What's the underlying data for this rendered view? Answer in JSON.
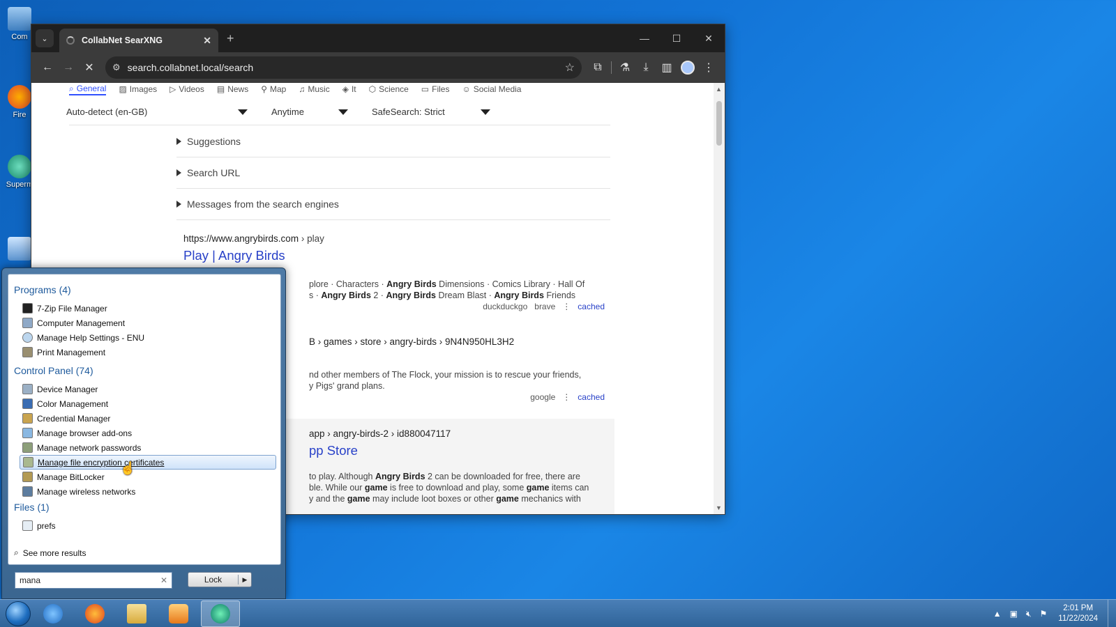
{
  "desktop": {
    "icons": [
      {
        "label": "Com",
        "icon": "computer-icon"
      },
      {
        "label": "Fire",
        "icon": "firefox-shortcut-icon"
      },
      {
        "label": "Superm",
        "icon": "app-shortcut-icon"
      },
      {
        "label": "",
        "icon": "shortcut-icon"
      }
    ]
  },
  "browser": {
    "tab_title": "CollabNet SearXNG",
    "url": "search.collabnet.local/search",
    "categories": [
      "General",
      "Images",
      "Videos",
      "News",
      "Map",
      "Music",
      "It",
      "Science",
      "Files",
      "Social Media"
    ],
    "filters": {
      "language": "Auto-detect (en-GB)",
      "time": "Anytime",
      "safesearch": "SafeSearch: Strict"
    },
    "expanders": [
      "Suggestions",
      "Search URL",
      "Messages from the search engines"
    ],
    "results": [
      {
        "url": "https://www.angrybirds.com",
        "crumb": "› play",
        "title": "Play | Angry Birds",
        "snippet_html_1": "plore · Characters · <b>Angry Birds</b> Dimensions · Comics Library · Hall Of",
        "snippet_html_2": "s · <b>Angry Birds</b> 2 · <b>Angry Birds</b> Dream Blast · <b>Angry Birds</b> Friends",
        "engines": [
          "duckduckgo",
          "brave"
        ],
        "cached": "cached"
      },
      {
        "url": "B › games › store › angry-birds › 9N4N950HL3H2",
        "snippet_html_1": "nd other members of The Flock, your mission is to rescue your friends,",
        "snippet_html_2": "y Pigs' grand plans.",
        "engines": [
          "google"
        ],
        "cached": "cached"
      },
      {
        "url": "app › angry-birds-2 › id880047117",
        "title": "pp Store",
        "snippet_html_1": "to play. Although <b>Angry Birds</b> 2 can be downloaded for free, there are",
        "snippet_html_2": "ble. While our <b>game</b> is free to download and play, some <b>game</b> items can",
        "snippet_html_3": "y and the <b>game</b> may include loot boxes or other <b>game</b> mechanics with"
      }
    ]
  },
  "start_menu": {
    "programs_heading": "Programs (4)",
    "programs": [
      "7-Zip File Manager",
      "Computer Management",
      "Manage Help Settings - ENU",
      "Print Management"
    ],
    "control_panel_heading": "Control Panel (74)",
    "control_panel": [
      "Device Manager",
      "Color Management",
      "Credential Manager",
      "Manage browser add-ons",
      "Manage network passwords",
      "Manage file encryption certificates",
      "Manage BitLocker",
      "Manage wireless networks"
    ],
    "selected_item": "Manage file encryption certificates",
    "files_heading": "Files (1)",
    "files": [
      "prefs"
    ],
    "see_more": "See more results",
    "search_value": "mana",
    "lock_label": "Lock"
  },
  "taskbar": {
    "apps": [
      "internet-explorer-icon",
      "firefox-icon",
      "file-explorer-icon",
      "media-player-icon",
      "edge-beta-icon"
    ],
    "time": "2:01 PM",
    "date": "11/22/2024"
  }
}
